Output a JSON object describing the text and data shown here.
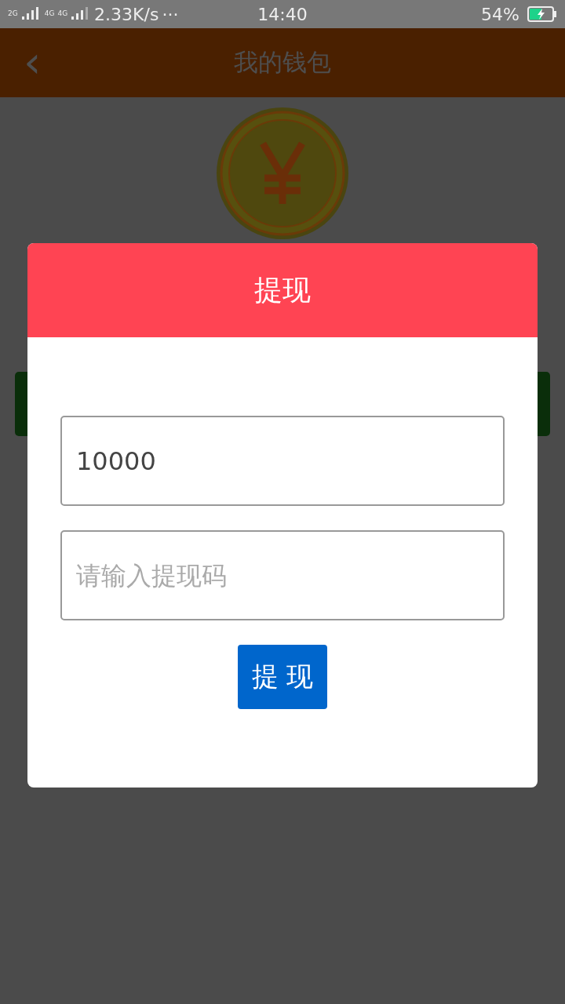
{
  "status_bar": {
    "sim_labels": [
      "2G",
      "4G",
      "4G"
    ],
    "speed": "2.33K/s",
    "more": "···",
    "time": "14:40",
    "battery_percent": "54%",
    "charging": true
  },
  "header": {
    "back": "‹",
    "title": "我的钱包"
  },
  "dialog": {
    "title": "提现",
    "fields": [
      {
        "value": "10000"
      },
      {
        "placeholder": "请输入提现码"
      }
    ],
    "button": "提 现"
  }
}
